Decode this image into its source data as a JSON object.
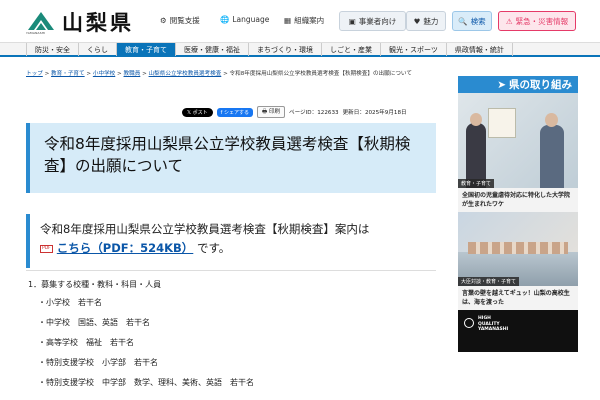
{
  "header": {
    "logo_sub": "YAMANASHI",
    "site_title": "山梨県",
    "links": {
      "braille": "閲覧支援",
      "language": "Language",
      "org": "組織案内"
    },
    "buttons": {
      "business": "事業者向け",
      "charm": "魅力",
      "search": "検索",
      "emergency": "緊急・災害情報"
    }
  },
  "nav": {
    "items": [
      "防災・安全",
      "くらし",
      "教育・子育て",
      "医療・健康・福祉",
      "まちづくり・環境",
      "しごと・産業",
      "観光・スポーツ",
      "県政情報・統計"
    ],
    "active": "教育・子育て"
  },
  "breadcrumb": [
    "トップ",
    "教育・子育て",
    "小中学校",
    "教職員",
    "山梨県公立学校教員選考検査",
    "令和8年度採用山梨県公立学校教員選考検査【秋期検査】の出願について"
  ],
  "share": {
    "x": "ポスト",
    "facebook": "シェアする",
    "print": "印刷",
    "page_id": "ページID：122633",
    "updated": "更新日：2025年9月18日"
  },
  "title": "令和8年度採用山梨県公立学校教員選考検査【秋期検査】の出願について",
  "lead": {
    "text": "令和8年度採用山梨県公立学校教員選考検査【秋期検査】案内は",
    "pdf_badge": "PDF",
    "link": "こちら（PDF：524KB）",
    "tail": "です。"
  },
  "list": {
    "heading": "1．募集する校種・教科・科目・人員",
    "items": [
      "・小学校　若干名",
      "・中学校　国語、英語　若干名",
      "・高等学校　福祉　若干名",
      "・特別支援学校　小学部　若干名",
      "・特別支援学校　中学部　数学、理科、美術、英語　若干名"
    ]
  },
  "sidebar": {
    "heading": "県の取り組み",
    "cards": [
      {
        "tag": "教育・子育て",
        "caption": "全国初の児童虐待対応に特化した大学院が生まれたワケ"
      },
      {
        "tag": "大臣対談・教育・子育て",
        "caption": "言葉の壁を越えてギュッ！山梨の高校生は、海を渡った"
      },
      {
        "tag": "",
        "caption": ""
      }
    ],
    "banner_text": "HIGH QUALITY YAMANASHI"
  },
  "colors": {
    "accent": "#0a74b9",
    "title_bg": "#d6ebf8",
    "emergency": "#e53a68",
    "search": "#2a8bd0"
  }
}
